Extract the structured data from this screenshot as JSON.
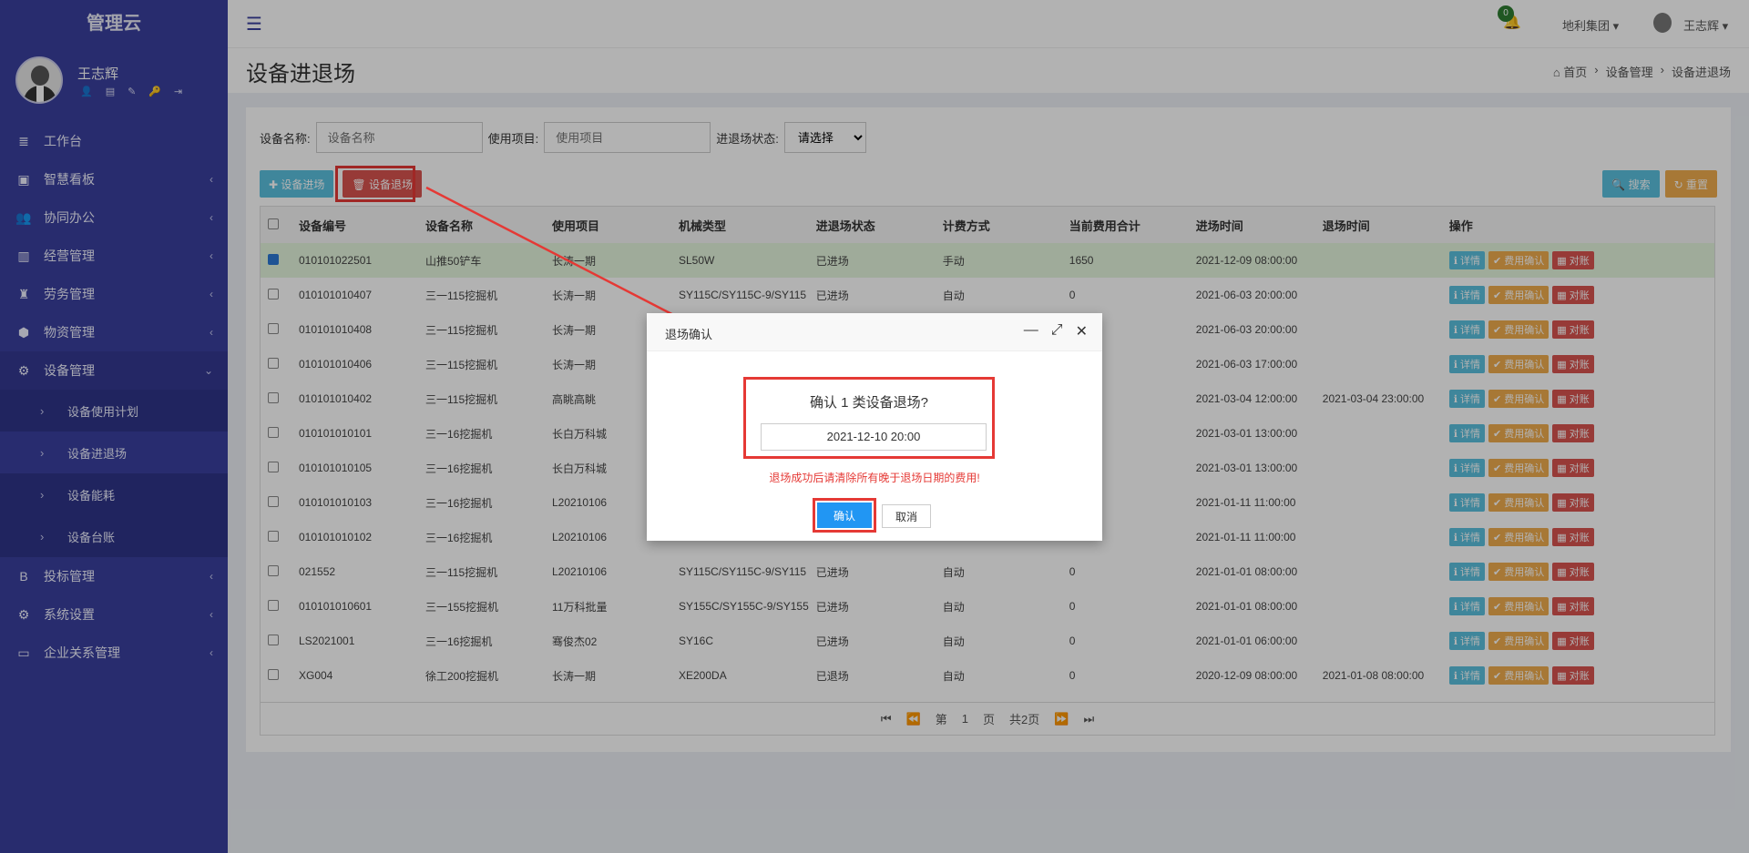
{
  "app": {
    "brand": "管理云"
  },
  "user": {
    "name": "王志辉"
  },
  "user_tools": [
    "👤",
    "▤",
    "✎",
    "🔑",
    "⇥"
  ],
  "menu": [
    {
      "label": "工作台",
      "icon": "≣",
      "chev": ""
    },
    {
      "label": "智慧看板",
      "icon": "▣",
      "chev": "‹"
    },
    {
      "label": "协同办公",
      "icon": "👥",
      "chev": "‹"
    },
    {
      "label": "经营管理",
      "icon": "▥",
      "chev": "‹"
    },
    {
      "label": "劳务管理",
      "icon": "♜",
      "chev": "‹"
    },
    {
      "label": "物资管理",
      "icon": "⬢",
      "chev": "‹"
    },
    {
      "label": "设备管理",
      "icon": "⚙",
      "chev": "⌄"
    }
  ],
  "submenu": [
    {
      "label": "设备使用计划"
    },
    {
      "label": "设备进退场"
    },
    {
      "label": "设备能耗"
    },
    {
      "label": "设备台账"
    }
  ],
  "menu2": [
    {
      "label": "投标管理",
      "icon": "B",
      "chev": "‹"
    },
    {
      "label": "系统设置",
      "icon": "⚙",
      "chev": "‹"
    },
    {
      "label": "企业关系管理",
      "icon": "▭",
      "chev": "‹"
    }
  ],
  "topbar": {
    "notif_count": "0",
    "org": "地利集团 ▾",
    "user": "王志辉 ▾"
  },
  "page": {
    "title": "设备进退场",
    "breadcrumb": [
      "⌂ 首页",
      "›",
      "设备管理",
      "›",
      "设备进退场"
    ]
  },
  "filter": {
    "name_label": "设备名称:",
    "name_placeholder": "设备名称",
    "project_label": "使用项目:",
    "project_placeholder": "使用项目",
    "status_label": "进退场状态:",
    "status_selected": "请选择"
  },
  "toolbar": {
    "enter": "✚ 设备进场",
    "exit": "🗑 设备退场",
    "search": "🔍 搜索",
    "reset": "↻ 重置"
  },
  "table": {
    "headers": [
      "设备编号",
      "设备名称",
      "使用项目",
      "机械类型",
      "进退场状态",
      "计费方式",
      "当前费用合计",
      "进场时间",
      "退场时间",
      "操作"
    ],
    "rows": [
      {
        "checked": true,
        "cells": [
          "010101022501",
          "山推50铲车",
          "长涛一期",
          "SL50W",
          "已进场",
          "手动",
          "1650",
          "2021-12-09 08:00:00",
          ""
        ]
      },
      {
        "checked": false,
        "cells": [
          "010101010407",
          "三一115挖掘机",
          "长涛一期",
          "SY115C/SY115C-9/SY115",
          "已进场",
          "自动",
          "0",
          "2021-06-03 20:00:00",
          ""
        ]
      },
      {
        "checked": false,
        "cells": [
          "010101010408",
          "三一115挖掘机",
          "长涛一期",
          "",
          "",
          "",
          "",
          "2021-06-03 20:00:00",
          ""
        ]
      },
      {
        "checked": false,
        "cells": [
          "010101010406",
          "三一115挖掘机",
          "长涛一期",
          "",
          "",
          "",
          "",
          "2021-06-03 17:00:00",
          ""
        ]
      },
      {
        "checked": false,
        "cells": [
          "010101010402",
          "三一115挖掘机",
          "高眺高眺",
          "",
          "",
          "",
          "",
          "2021-03-04 12:00:00",
          "2021-03-04 23:00:00"
        ]
      },
      {
        "checked": false,
        "cells": [
          "010101010101",
          "三一16挖掘机",
          "长白万科城",
          "",
          "",
          "",
          "",
          "2021-03-01 13:00:00",
          ""
        ]
      },
      {
        "checked": false,
        "cells": [
          "010101010105",
          "三一16挖掘机",
          "长白万科城",
          "",
          "",
          "",
          "",
          "2021-03-01 13:00:00",
          ""
        ]
      },
      {
        "checked": false,
        "cells": [
          "010101010103",
          "三一16挖掘机",
          "L20210106",
          "",
          "",
          "",
          "",
          "2021-01-11 11:00:00",
          ""
        ]
      },
      {
        "checked": false,
        "cells": [
          "010101010102",
          "三一16挖掘机",
          "L20210106",
          "",
          "",
          "",
          "",
          "2021-01-11 11:00:00",
          ""
        ]
      },
      {
        "checked": false,
        "cells": [
          "021552",
          "三一115挖掘机",
          "L20210106",
          "SY115C/SY115C-9/SY115",
          "已进场",
          "自动",
          "0",
          "2021-01-01 08:00:00",
          ""
        ]
      },
      {
        "checked": false,
        "cells": [
          "010101010601",
          "三一155挖掘机",
          "11万科批量",
          "SY155C/SY155C-9/SY155",
          "已进场",
          "自动",
          "0",
          "2021-01-01 08:00:00",
          ""
        ]
      },
      {
        "checked": false,
        "cells": [
          "LS2021001",
          "三一16挖掘机",
          "骞俊杰02",
          "SY16C",
          "已进场",
          "自动",
          "0",
          "2021-01-01 06:00:00",
          ""
        ]
      },
      {
        "checked": false,
        "cells": [
          "XG004",
          "徐工200挖掘机",
          "长涛一期",
          "XE200DA",
          "已退场",
          "自动",
          "0",
          "2020-12-09 08:00:00",
          "2021-01-08 08:00:00"
        ]
      }
    ],
    "actions": [
      "ℹ 详情",
      "✔ 费用确认",
      "▦ 对账"
    ]
  },
  "pager": {
    "first": "⏮",
    "prev": "⏪",
    "page_prefix": "第",
    "page": "1",
    "page_suffix": "页",
    "total": "共2页",
    "next": "⏩",
    "last": "⏭"
  },
  "dialog": {
    "title": "退场确认",
    "confirm_text": "确认    1    类设备退场?",
    "date": "2021-12-10 20:00",
    "warning": "退场成功后请清除所有晚于退场日期的费用!",
    "ok": "确认",
    "cancel": "取消",
    "ctrl_min": "—",
    "ctrl_max": "⤢",
    "ctrl_close": "✕"
  },
  "colors": {
    "sidebar": "#3a3f9e",
    "accent": "#e53935",
    "confirm": "#2196f3",
    "detail": "#5bc0de",
    "fee": "#f0ad4e",
    "reconcile": "#d9534f"
  }
}
